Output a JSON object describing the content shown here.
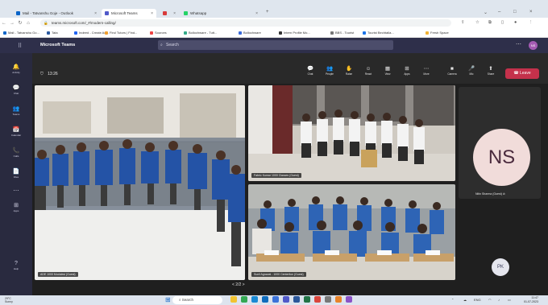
{
  "browser": {
    "tabs": [
      {
        "label": "Mail - Tatvanshu Goje - Outlook",
        "icon": "outlook-icon",
        "color": "#0a64c8",
        "active": false
      },
      {
        "label": "Microsoft Teams",
        "icon": "teams-icon",
        "color": "#5059c9",
        "active": true
      },
      {
        "label": "",
        "icon": "app-icon",
        "color": "#d83b3b",
        "active": false
      },
      {
        "label": "Whatsapp",
        "icon": "whatsapp-icon",
        "color": "#25d366",
        "active": false
      }
    ],
    "url": "teams.microsoft.com/_#/modern-calling/",
    "bookmarks": [
      {
        "label": "Mail - Tatvanshu Go...",
        "color": "#0a64c8"
      },
      {
        "label": "Tata",
        "color": "#2c5aa0"
      },
      {
        "label": "Indeed - Create Ac...",
        "color": "#2164f3"
      },
      {
        "label": "Find Tutors | Find...",
        "color": "#f0a030"
      },
      {
        "label": "Sources",
        "color": "#e44"
      },
      {
        "label": "Bollochware - Tutt...",
        "color": "#3a8"
      },
      {
        "label": "Bollochware",
        "color": "#3a6ad9"
      },
      {
        "label": "Intern Profile Mo...",
        "color": "#333"
      },
      {
        "label": "BBS - Tourist",
        "color": "#777"
      },
      {
        "label": "Tourist Bechtalla...",
        "color": "#1a73e8"
      },
      {
        "label": "Fresh Space",
        "color": "#f2b233"
      }
    ]
  },
  "teams": {
    "title": "Microsoft Teams",
    "search_placeholder": "Search",
    "user_initials": "NS"
  },
  "rail": [
    {
      "icon": "activity-icon",
      "glyph": "🔔",
      "label": "Activity"
    },
    {
      "icon": "chat-icon",
      "glyph": "💬",
      "label": "Chat"
    },
    {
      "icon": "teams-icon",
      "glyph": "👥",
      "label": "Teams"
    },
    {
      "icon": "calendar-icon",
      "glyph": "📅",
      "label": "Calendar"
    },
    {
      "icon": "calls-icon",
      "glyph": "📞",
      "label": "Calls"
    },
    {
      "icon": "files-icon",
      "glyph": "📄",
      "label": "Files"
    },
    {
      "icon": "more-icon",
      "glyph": "⋯",
      "label": ""
    },
    {
      "icon": "apps-icon",
      "glyph": "⊞",
      "label": "Apps"
    },
    {
      "icon": "help-icon",
      "glyph": "?",
      "label": "Help"
    }
  ],
  "meeting": {
    "timer": "13:26",
    "toolbar": [
      {
        "icon": "chat-icon",
        "glyph": "💬",
        "label": "Chat"
      },
      {
        "icon": "people-icon",
        "glyph": "👥",
        "label": "People"
      },
      {
        "icon": "raise-hand-icon",
        "glyph": "✋",
        "label": "Raise"
      },
      {
        "icon": "react-icon",
        "glyph": "☺",
        "label": "React"
      },
      {
        "icon": "view-icon",
        "glyph": "▦",
        "label": "View"
      },
      {
        "icon": "apps-icon",
        "glyph": "⊞",
        "label": "Apps"
      },
      {
        "icon": "more-icon",
        "glyph": "⋯",
        "label": "More"
      },
      {
        "icon": "camera-icon",
        "glyph": "■",
        "label": "Camera"
      },
      {
        "icon": "mic-icon",
        "glyph": "🎤",
        "label": "Mic"
      },
      {
        "icon": "share-icon",
        "glyph": "⬆",
        "label": "Share"
      }
    ],
    "leave_label": "Leave",
    "participants": [
      {
        "label": "ADE 1000 Modulesi (Guest)"
      },
      {
        "label": "Fabric Kumar 1000 Classes (Guest)"
      },
      {
        "label": "Sunil Agrawal - 1000 Centerlion (Guest)"
      }
    ],
    "side_tile": {
      "initials": "NS",
      "label": "Nitin Sharma (Guest)"
    },
    "small_tile": {
      "initials": "PK"
    },
    "page": "< 2/2 >"
  },
  "taskbar": {
    "weather": [
      "29°C",
      "Sunny"
    ],
    "search": "Search",
    "apps": [
      {
        "icon": "file-explorer-icon",
        "color": "#f2c331"
      },
      {
        "icon": "chrome-icon",
        "color": "#34a853"
      },
      {
        "icon": "edge-icon",
        "color": "#1a8ad4"
      },
      {
        "icon": "mail-icon",
        "color": "#0f6cbd"
      },
      {
        "icon": "store-icon",
        "color": "#3b72d9"
      },
      {
        "icon": "teams-icon",
        "color": "#5059c9"
      },
      {
        "icon": "word-icon",
        "color": "#2b579a"
      },
      {
        "icon": "excel-icon",
        "color": "#217346"
      },
      {
        "icon": "photos-icon",
        "color": "#d9453c"
      },
      {
        "icon": "settings-icon",
        "color": "#777777"
      },
      {
        "icon": "app-icon",
        "color": "#e8832a"
      },
      {
        "icon": "app-icon",
        "color": "#8a52c7"
      }
    ],
    "lang": "ENG",
    "lang_sub": "IN",
    "time": "11:47",
    "date": "01-07-2023"
  }
}
